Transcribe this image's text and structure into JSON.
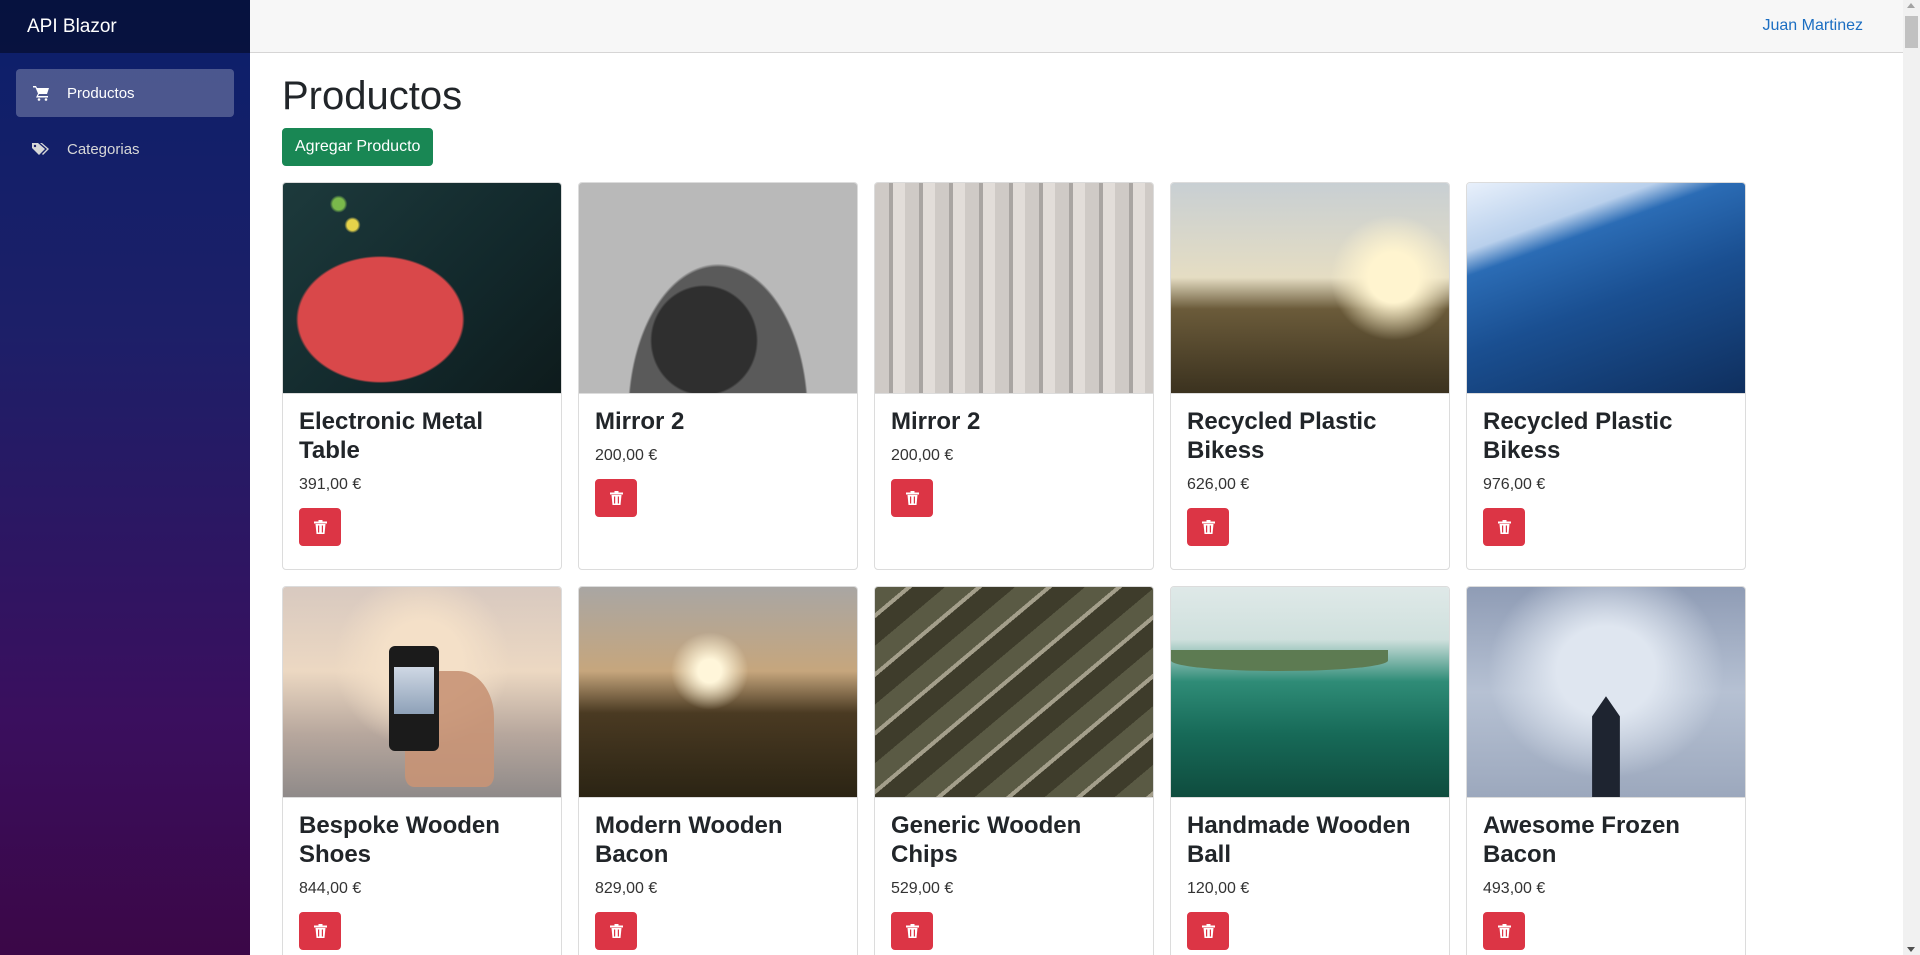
{
  "app": {
    "brand": "API Blazor"
  },
  "sidebar": {
    "items": [
      {
        "label": "Productos",
        "icon": "cart-icon",
        "active": true
      },
      {
        "label": "Categorias",
        "icon": "tags-icon",
        "active": false
      }
    ]
  },
  "topbar": {
    "user": "Juan Martinez"
  },
  "main": {
    "title": "Productos",
    "add_button": "Agregar Producto",
    "products": [
      {
        "name": "Electronic Metal Table",
        "price": "391,00 €",
        "image": "umbrella"
      },
      {
        "name": "Mirror 2",
        "price": "200,00 €",
        "image": "hair"
      },
      {
        "name": "Mirror 2",
        "price": "200,00 €",
        "image": "city"
      },
      {
        "name": "Recycled Plastic Bikess",
        "price": "626,00 €",
        "image": "valley"
      },
      {
        "name": "Recycled Plastic Bikess",
        "price": "976,00 €",
        "image": "wave"
      },
      {
        "name": "Bespoke Wooden Shoes",
        "price": "844,00 €",
        "image": "phone"
      },
      {
        "name": "Modern Wooden Bacon",
        "price": "829,00 €",
        "image": "forest"
      },
      {
        "name": "Generic Wooden Chips",
        "price": "529,00 €",
        "image": "guitar"
      },
      {
        "name": "Handmade Wooden Ball",
        "price": "120,00 €",
        "image": "canoe"
      },
      {
        "name": "Awesome Frozen Bacon",
        "price": "493,00 €",
        "image": "tower"
      }
    ]
  },
  "colors": {
    "add_button": "#198754",
    "delete_button": "#dc3545",
    "link": "#1b6ec2"
  }
}
